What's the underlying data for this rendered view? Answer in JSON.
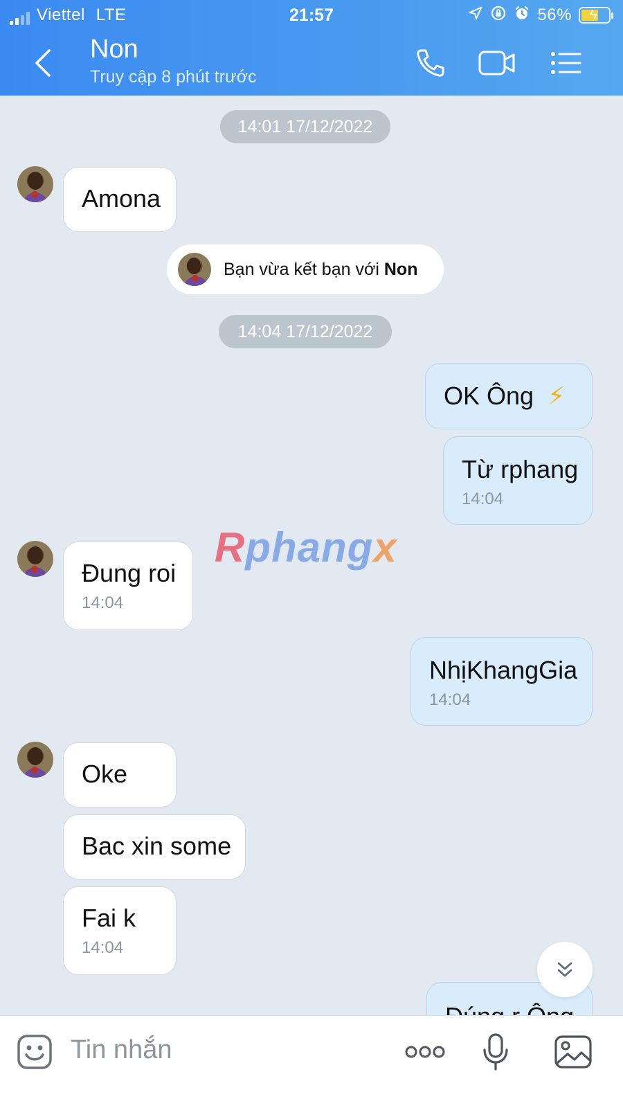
{
  "status_bar": {
    "carrier": "Viettel",
    "network": "LTE",
    "time": "21:57",
    "battery_percent": "56%"
  },
  "header": {
    "contact_name": "Non",
    "last_seen": "Truy cập 8 phút trước"
  },
  "messages": {
    "date_1": "14:01 17/12/2022",
    "m1": "Amona",
    "friend_notice_prefix": "Bạn vừa kết bạn với",
    "friend_notice_name": "Non",
    "date_2": "14:04 17/12/2022",
    "m2": "OK Ông",
    "m2_emoji": "⚡",
    "m3": "Từ rphang",
    "m3_time": "14:04",
    "m4": "Đung roi",
    "m4_time": "14:04",
    "m5": "NhịKhangGia",
    "m5_time": "14:04",
    "m6": "Oke",
    "m7": "Bac xin some",
    "m8": "Fai k",
    "m8_time": "14:04",
    "m9_partial": "Đúng r Ông"
  },
  "watermark": {
    "part1": "R",
    "part2": "phang",
    "part3": "x"
  },
  "input": {
    "placeholder": "Tin nhắn"
  },
  "colors": {
    "header_blue": "#3b8af1",
    "chat_background": "#e2e9f1",
    "outgoing_bubble": "#d8ecfb",
    "incoming_bubble": "#ffffff"
  }
}
